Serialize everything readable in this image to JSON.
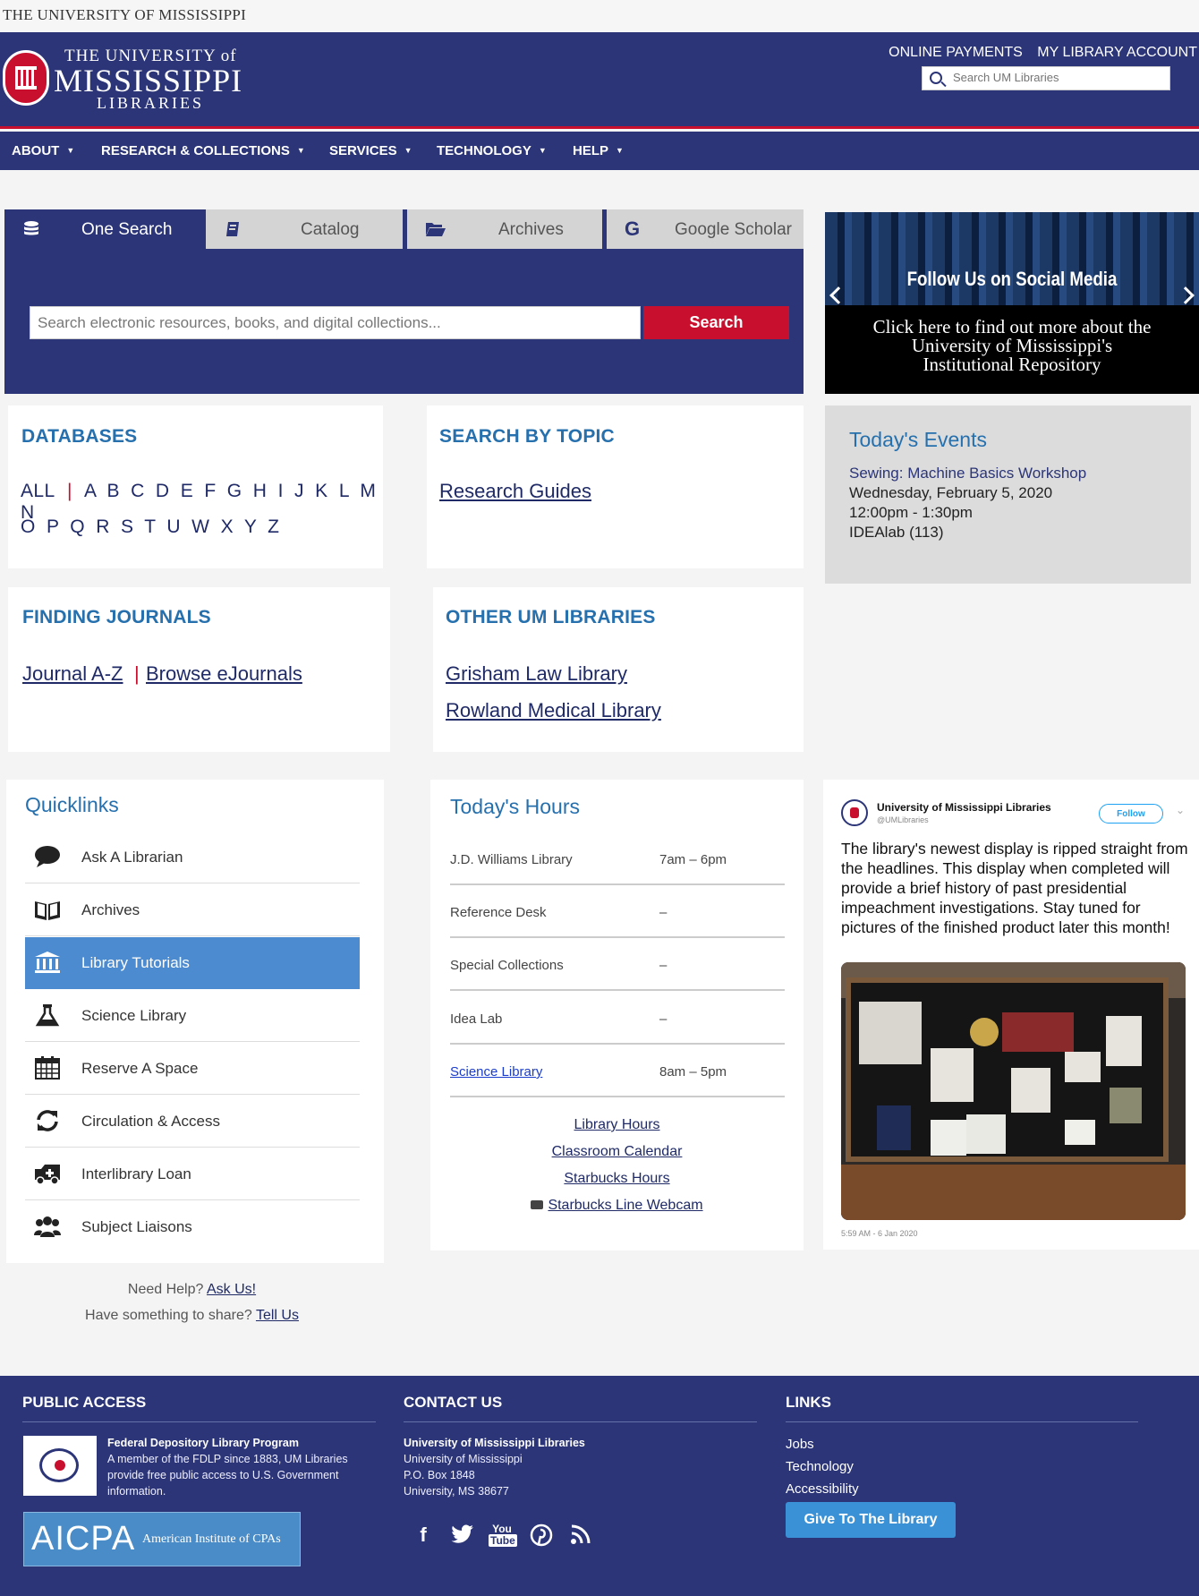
{
  "top_strip": {
    "text": "THE UNIVERSITY OF MISSISSIPPI"
  },
  "header": {
    "logo_line1": "THE UNIVERSITY of",
    "logo_line2": "MISSISSIPPI",
    "logo_line3": "LIBRARIES",
    "links": [
      "ONLINE PAYMENTS",
      "MY LIBRARY ACCOUNT"
    ],
    "search_placeholder": "Search UM Libraries"
  },
  "nav": {
    "items": [
      "ABOUT",
      "RESEARCH & COLLECTIONS",
      "SERVICES",
      "TECHNOLOGY",
      "HELP"
    ]
  },
  "search": {
    "tabs": [
      "One Search",
      "Catalog",
      "Archives",
      "Google Scholar"
    ],
    "active_tab": "One Search",
    "placeholder": "Search electronic resources, books, and digital collections...",
    "button": "Search"
  },
  "banner": {
    "title": "Follow Us on Social Media",
    "caption_line1": "Click here to find out more about the",
    "caption_line2": "University of Mississippi's",
    "caption_line3": "Institutional Repository"
  },
  "databases": {
    "heading": "DATABASES",
    "all": "ALL",
    "row1": "A B C D E F G H I J K L M N",
    "row2": "O P Q R S T U W X Y Z"
  },
  "topic": {
    "heading": "SEARCH BY TOPIC",
    "link": "Research Guides"
  },
  "events": {
    "heading": "Today's Events",
    "title": "Sewing: Machine Basics Workshop",
    "date": "Wednesday, February 5, 2020",
    "time": "12:00pm - 1:30pm",
    "place": "IDEAlab (113)"
  },
  "journals": {
    "heading": "FINDING JOURNALS",
    "link1": "Journal A-Z",
    "sep": "|",
    "link2": "Browse eJournals"
  },
  "other_libraries": {
    "heading": "OTHER UM LIBRARIES",
    "link1": "Grisham Law Library",
    "link2": "Rowland Medical Library"
  },
  "quicklinks": {
    "heading": "Quicklinks",
    "items": [
      {
        "label": "Ask A Librarian",
        "icon": "speech-bubble-icon"
      },
      {
        "label": "Archives",
        "icon": "open-book-icon"
      },
      {
        "label": "Library Tutorials",
        "icon": "institution-icon"
      },
      {
        "label": "Science Library",
        "icon": "flask-icon"
      },
      {
        "label": "Reserve A Space",
        "icon": "calendar-icon"
      },
      {
        "label": "Circulation & Access",
        "icon": "refresh-icon"
      },
      {
        "label": "Interlibrary Loan",
        "icon": "ambulance-icon"
      },
      {
        "label": "Subject Liaisons",
        "icon": "users-icon"
      }
    ],
    "active": "Library Tutorials"
  },
  "hours": {
    "heading": "Today's Hours",
    "rows": [
      {
        "name": "J.D. Williams Library",
        "time": "7am – 6pm"
      },
      {
        "name": "Reference Desk",
        "time": "–"
      },
      {
        "name": "Special Collections",
        "time": "–"
      },
      {
        "name": "Idea Lab",
        "time": "–"
      },
      {
        "name": "Science Library",
        "time": "8am – 5pm"
      }
    ],
    "links": [
      "Library Hours",
      "Classroom Calendar",
      "Starbucks Hours",
      "Starbucks Line Webcam"
    ]
  },
  "tweet": {
    "account": "University of Mississippi Libraries",
    "handle": "@UMLibraries",
    "follow": "Follow",
    "text": "The library's newest display is ripped straight from the headlines. This display when completed will provide a brief history of past presidential impeachment investigations. Stay tuned for pictures of the finished product later this month!",
    "timestamp": "5:59 AM - 6 Jan 2020"
  },
  "help": {
    "need": "Need Help?",
    "ask": "Ask Us!",
    "share": "Have something to share?",
    "tell": "Tell Us"
  },
  "footer": {
    "public_access": {
      "heading": "PUBLIC ACCESS",
      "program": "Federal Depository Library Program",
      "desc1": "A member of the FDLP since 1883, UM Libraries",
      "desc2": "provide free public access to U.S. Government",
      "desc3": "information.",
      "aicpa": "AICPA",
      "aicpa_full": "American Institute of CPAs"
    },
    "contact": {
      "heading": "CONTACT US",
      "name": "University of Mississippi Libraries",
      "line1": "University of Mississippi",
      "line2": "P.O. Box 1848",
      "line3": "University, MS 38677",
      "social": [
        "facebook-icon",
        "twitter-icon",
        "youtube-icon",
        "pinterest-icon",
        "rss-icon"
      ]
    },
    "links": {
      "heading": "LINKS",
      "items": [
        "Jobs",
        "Technology",
        "Accessibility"
      ],
      "give": "Give To The Library"
    }
  },
  "colors": {
    "navy": "#2b3577",
    "red": "#c8102e",
    "blue": "#2670ae",
    "highlight": "#4c8bcf"
  }
}
